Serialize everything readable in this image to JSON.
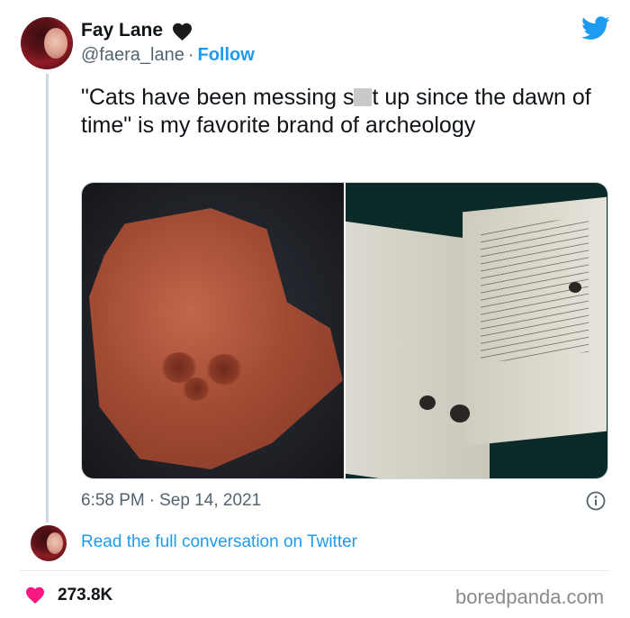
{
  "user": {
    "name": "Fay Lane",
    "handle": "@faera_lane",
    "separator": "·",
    "follow_label": "Follow"
  },
  "tweet": {
    "text_before": "\"Cats have been messing s",
    "text_after": "t up since the dawn of time\" is my favorite brand of archeology",
    "time": "6:58 PM",
    "date_separator": "·",
    "date": "Sep 14, 2021"
  },
  "thread": {
    "read_more_label": "Read the full conversation on Twitter"
  },
  "engagement": {
    "likes": "273.8K"
  },
  "watermark": "boredpanda.com",
  "colors": {
    "accent": "#1d9bf0",
    "like": "#f91880",
    "text": "#0f1419",
    "secondary": "#536471"
  },
  "icons": [
    "black-heart-icon",
    "twitter-bird-icon",
    "info-icon",
    "like-heart-icon"
  ]
}
